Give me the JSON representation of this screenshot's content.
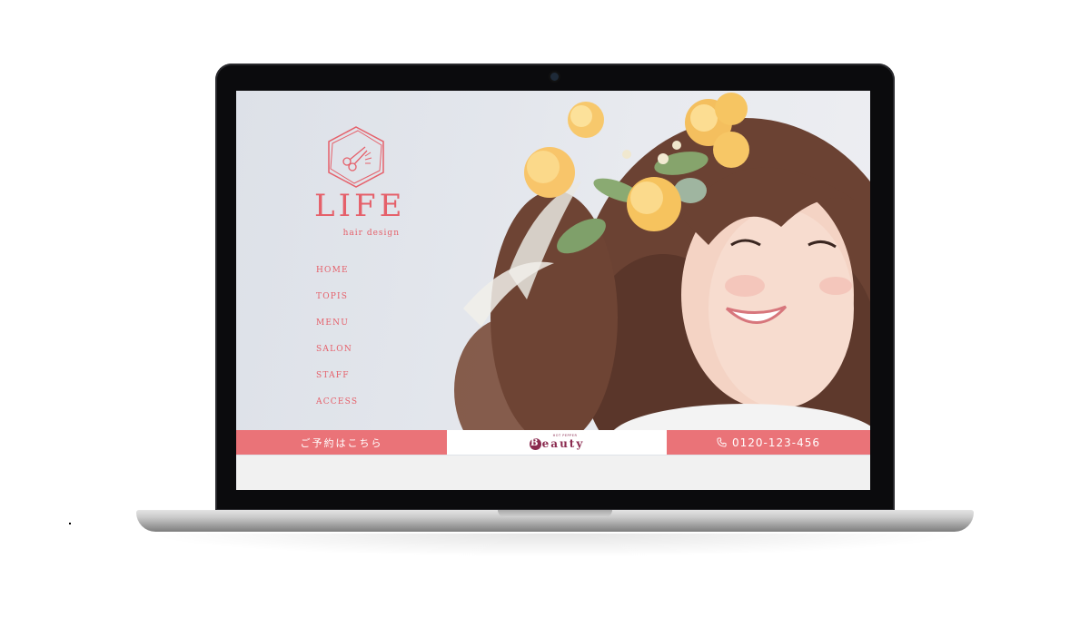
{
  "site": {
    "logo_text": "LIFE",
    "logo_sub": "hair design",
    "logo_icon": "scissors-hexagon-icon",
    "brand_color": "#e5606a"
  },
  "nav": {
    "items": [
      "HOME",
      "TOPIS",
      "MENU",
      "SALON",
      "STAFF",
      "ACCESS"
    ]
  },
  "bar": {
    "reserve_label": "ご予約はこちら",
    "beauty_small": "HOT PEPPER",
    "beauty_logo": "eauty",
    "beauty_initial": "B",
    "phone_icon": "phone-icon",
    "phone": "0120-123-456",
    "bar_color": "#ea7378",
    "beauty_color": "#8a2a4f"
  }
}
